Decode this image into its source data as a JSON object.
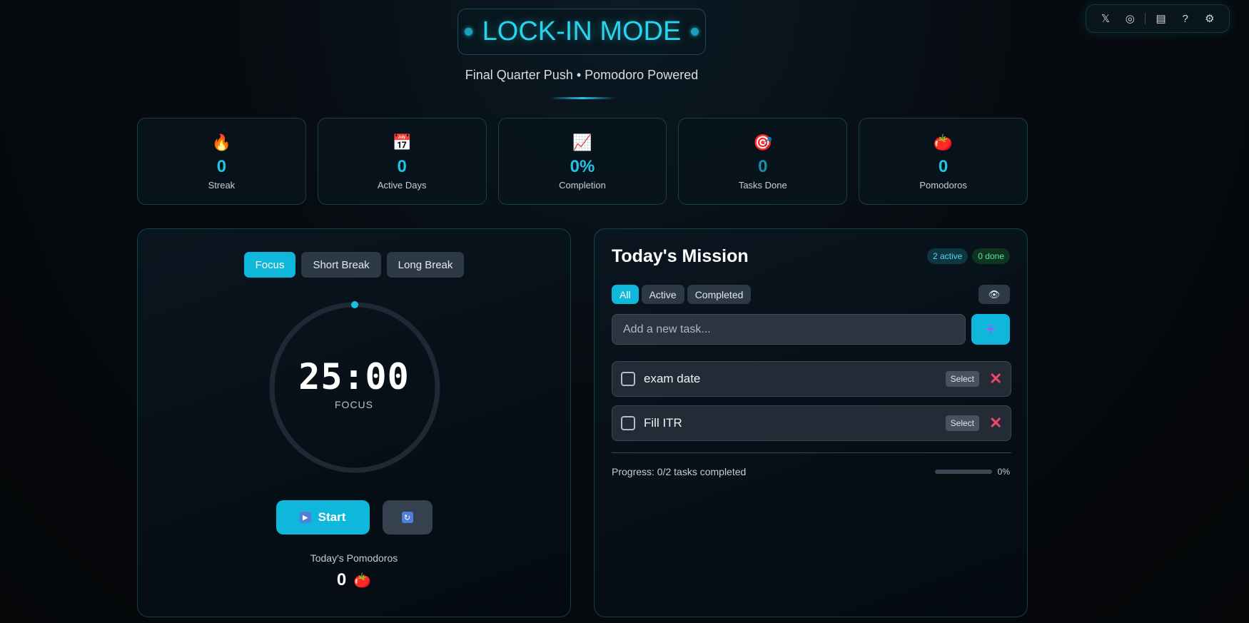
{
  "header": {
    "title": "LOCK-IN MODE",
    "subtitle": "Final Quarter Push • Pomodoro Powered"
  },
  "toolbar": [
    {
      "icon": "x-logo-icon",
      "glyph": "𝕏"
    },
    {
      "icon": "github-icon",
      "glyph": "◎"
    },
    {
      "icon": "notes-icon",
      "glyph": "▤"
    },
    {
      "icon": "help-icon",
      "glyph": "?"
    },
    {
      "icon": "settings-icon",
      "glyph": "⚙"
    }
  ],
  "stats": [
    {
      "icon": "fire-icon",
      "glyph": "🔥",
      "value": "0",
      "label": "Streak"
    },
    {
      "icon": "calendar-icon",
      "glyph": "📅",
      "value": "0",
      "label": "Active Days"
    },
    {
      "icon": "chart-icon",
      "glyph": "📈",
      "value": "0%",
      "label": "Completion"
    },
    {
      "icon": "target-icon",
      "glyph": "🎯",
      "value": "0",
      "label": "Tasks Done"
    },
    {
      "icon": "tomato-icon",
      "glyph": "🍅",
      "value": "0",
      "label": "Pomodoros"
    }
  ],
  "timer": {
    "modes": [
      "Focus",
      "Short Break",
      "Long Break"
    ],
    "active_mode": "Focus",
    "time": "25:00",
    "label": "FOCUS",
    "progress": 0,
    "start_label": "Start",
    "today_label": "Today's Pomodoros",
    "today_value": "0"
  },
  "mission": {
    "title": "Today's Mission",
    "active_badge": "2 active",
    "done_badge": "0 done",
    "filters": [
      "All",
      "Active",
      "Completed"
    ],
    "active_filter": "All",
    "input_placeholder": "Add a new task...",
    "add_glyph": "+",
    "tasks": [
      {
        "text": "exam date",
        "select_label": "Select",
        "done": false
      },
      {
        "text": "Fill ITR",
        "select_label": "Select",
        "done": false
      }
    ],
    "progress_text": "Progress: 0/2 tasks completed",
    "progress_percent": 0,
    "progress_label": "0%"
  },
  "colors": {
    "accent": "#0fb8da",
    "danger": "#f0466b",
    "panel_border": "#14404c"
  }
}
